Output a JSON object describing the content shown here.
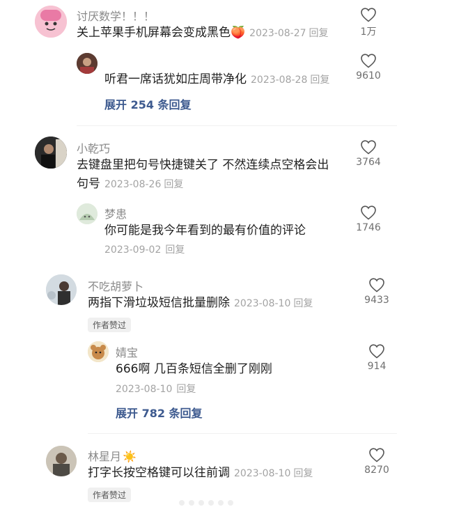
{
  "comments": [
    {
      "name": "讨厌数学！！！",
      "text": "关上苹果手机屏幕会变成黑色",
      "emoji": "🍑",
      "date": "2023-08-27",
      "reply": "回复",
      "likes": "1万"
    },
    {
      "text": "听君一席话犹如庄周带净化",
      "date": "2023-08-28",
      "reply": "回复",
      "likes": "9610",
      "expand": "展开 254 条回复"
    },
    {
      "name": "小乾巧",
      "text_line1": "去键盘里把句号快捷键关了 不然连续点空格会出",
      "text_line2": "句号",
      "date": "2023-08-26",
      "reply": "回复",
      "likes": "3764"
    },
    {
      "name": "梦患",
      "text": "你可能是我今年看到的最有价值的评论",
      "date": "2023-09-02",
      "reply": "回复",
      "likes": "1746"
    },
    {
      "name": "不吃胡萝卜",
      "text": "两指下滑垃圾短信批量删除",
      "date": "2023-08-10",
      "reply": "回复",
      "likes": "9433",
      "badge": "作者赞过"
    },
    {
      "name": "婧宝",
      "text": "666啊 几百条短信全删了刚刚",
      "date": "2023-08-10",
      "reply": "回复",
      "likes": "914",
      "expand": "展开 782 条回复"
    },
    {
      "name": "林星月",
      "name_emoji": "☀️",
      "text": "打字长按空格键可以往前调",
      "date": "2023-08-10",
      "reply": "回复",
      "likes": "8270",
      "badge": "作者赞过"
    }
  ],
  "colors": {
    "name": "#8a8a8a",
    "text": "#1f1f1f",
    "meta": "#a3a3a3",
    "link": "#3d5a8f"
  }
}
